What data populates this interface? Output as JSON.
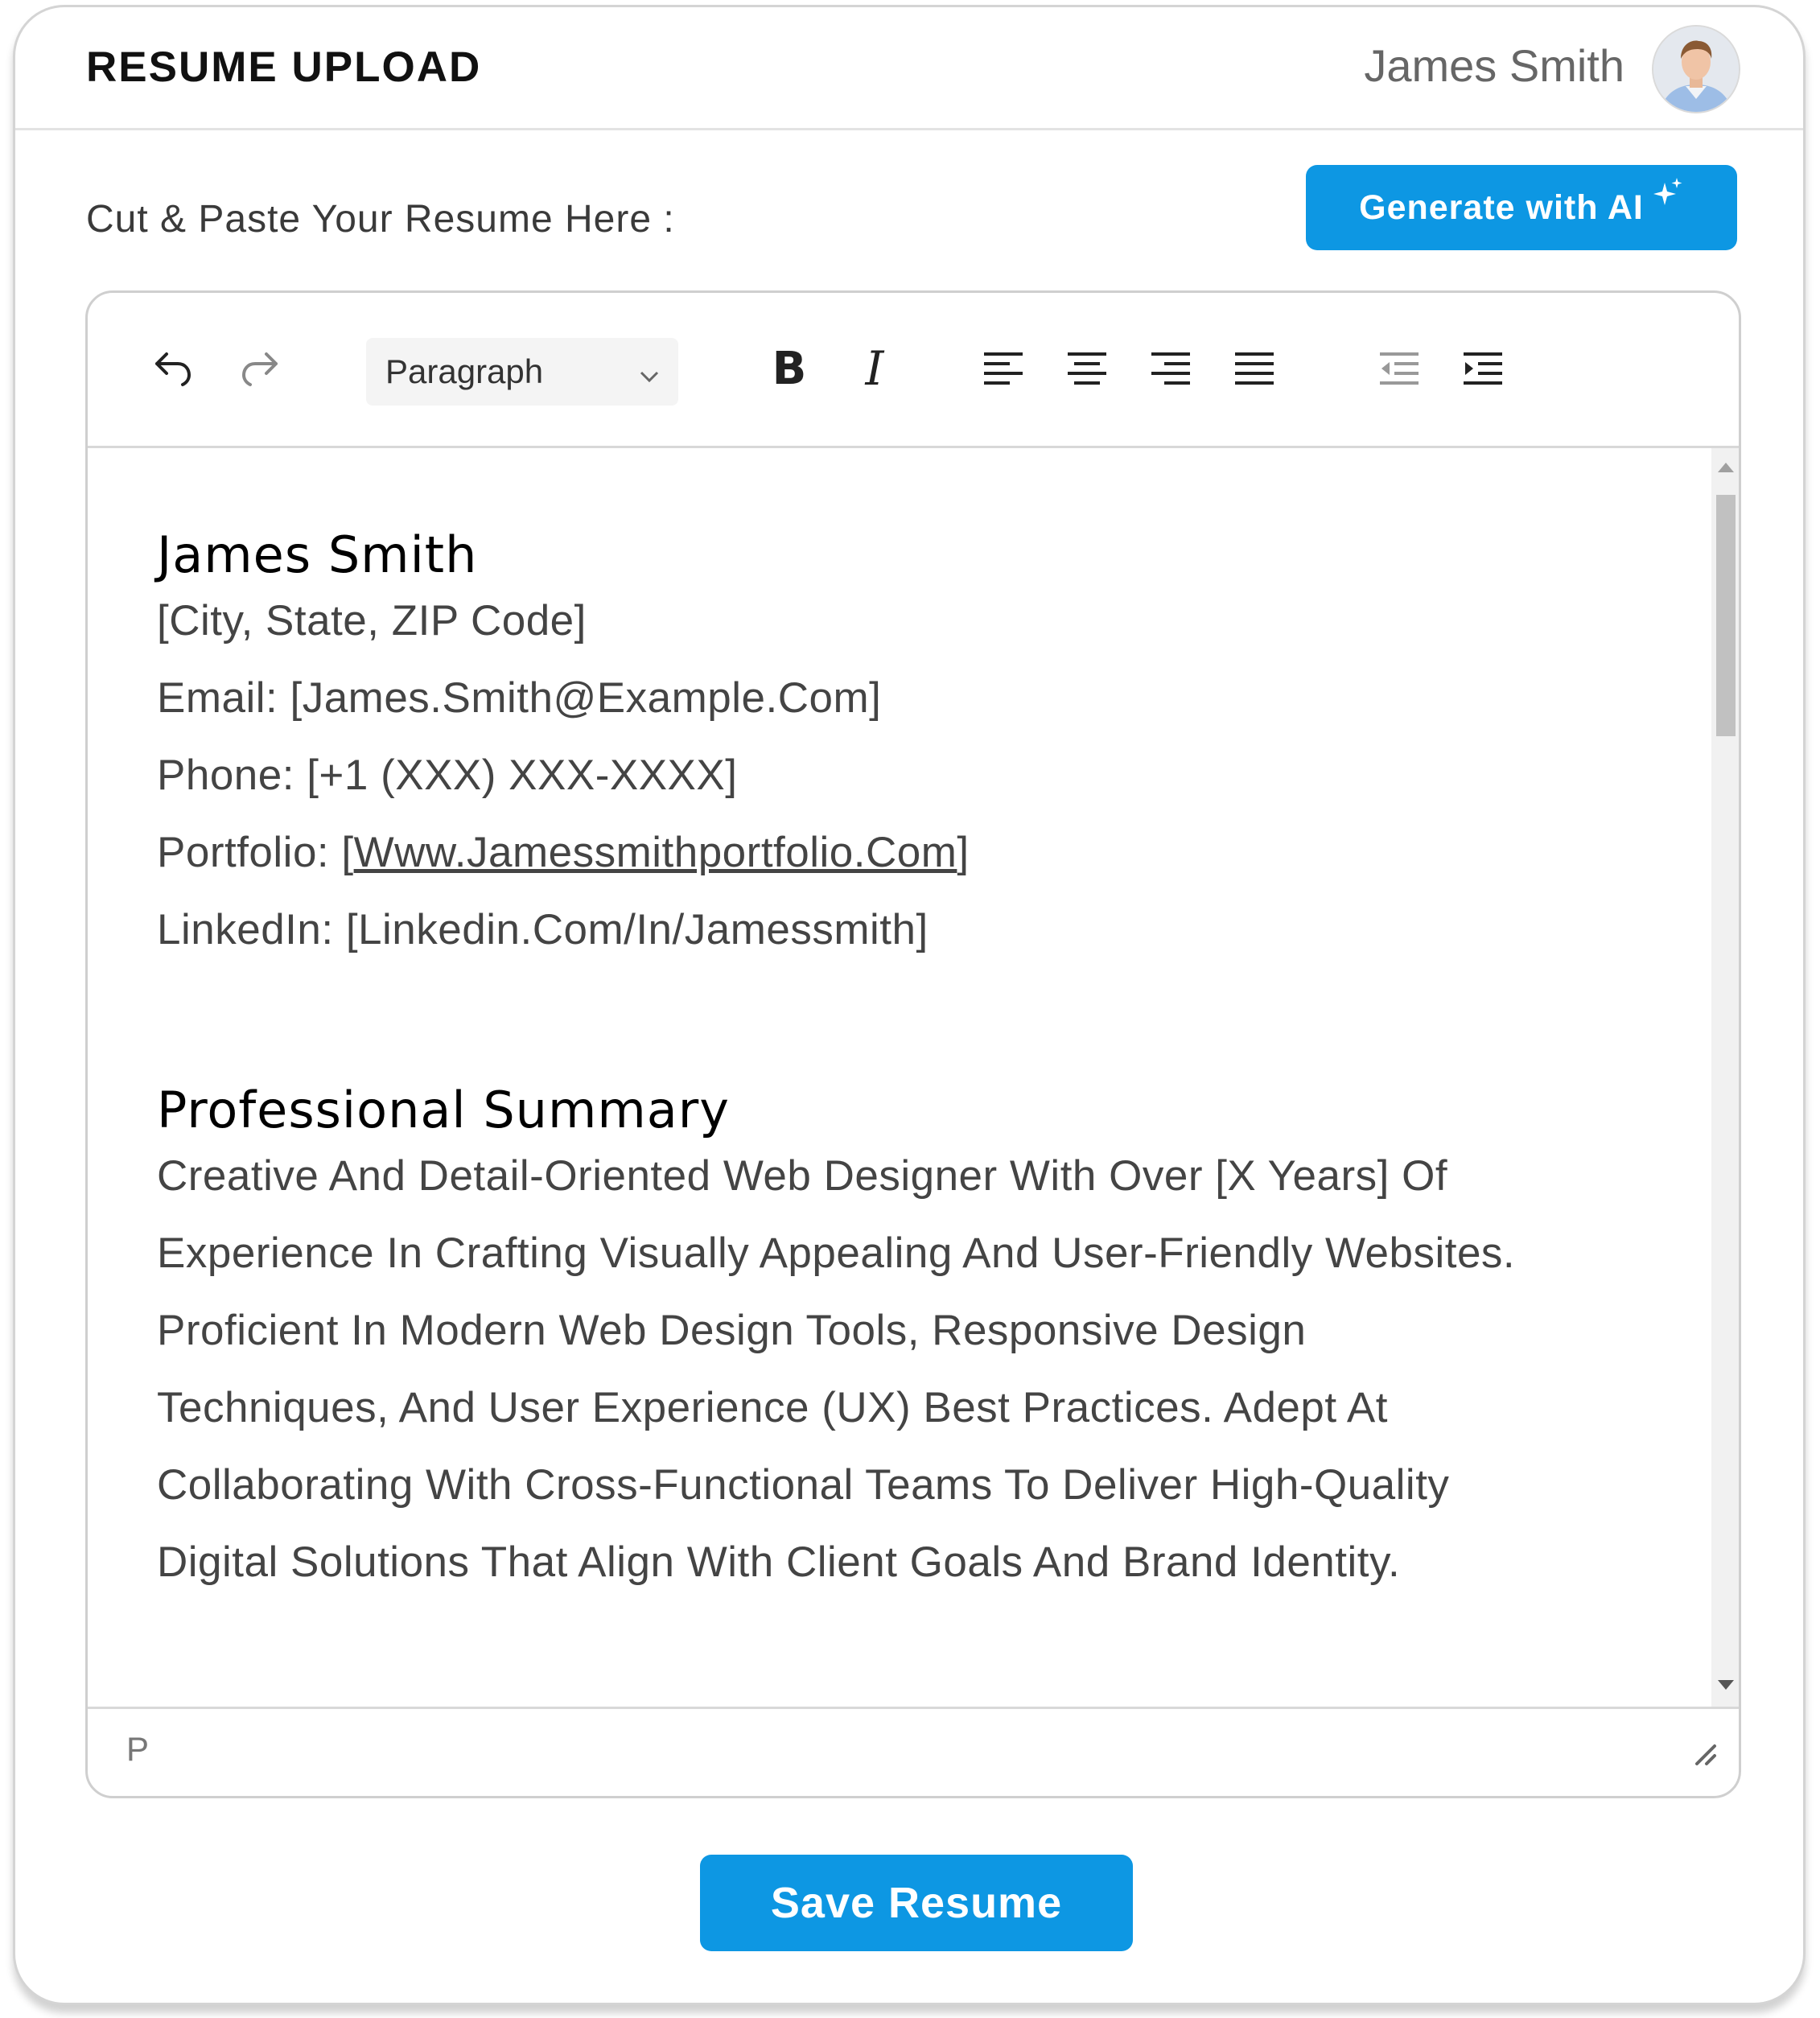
{
  "header": {
    "title": "RESUME UPLOAD",
    "user_name": "James Smith"
  },
  "form": {
    "paste_label": "Cut & Paste Your Resume Here :",
    "ai_button_label": "Generate with AI",
    "save_button_label": "Save Resume"
  },
  "toolbar": {
    "block_format": "Paragraph",
    "icons": [
      "undo-icon",
      "redo-icon",
      "bold-icon",
      "italic-icon",
      "align-left-icon",
      "align-center-icon",
      "align-right-icon",
      "align-justify-icon",
      "outdent-icon",
      "indent-icon"
    ]
  },
  "document": {
    "name_heading": "James Smith",
    "contact_lines": [
      "[City, State, ZIP Code]",
      "Email: [James.Smith@Example.Com]",
      "Phone: [+1 (XXX) XXX-XXXX]"
    ],
    "portfolio_prefix": "Portfolio: [",
    "portfolio_link": "Www.Jamessmithportfolio.Com",
    "portfolio_suffix": "]",
    "linkedin_line": "LinkedIn: [Linkedin.Com/In/Jamessmith]",
    "summary_heading": "Professional Summary",
    "summary_lines": [
      "Creative And Detail-Oriented Web Designer With Over [X Years] Of",
      "Experience In Crafting Visually Appealing And User-Friendly Websites.",
      "Proficient In Modern Web Design Tools, Responsive Design",
      "Techniques, And User Experience (UX) Best Practices. Adept At",
      "Collaborating With Cross-Functional Teams To Deliver High-Quality",
      "Digital Solutions That Align With Client Goals And Brand Identity."
    ]
  },
  "status_bar": {
    "element_path": "P"
  },
  "colors": {
    "accent": "#0d97e3",
    "text_muted": "#444444",
    "border": "#cfcfcf"
  }
}
